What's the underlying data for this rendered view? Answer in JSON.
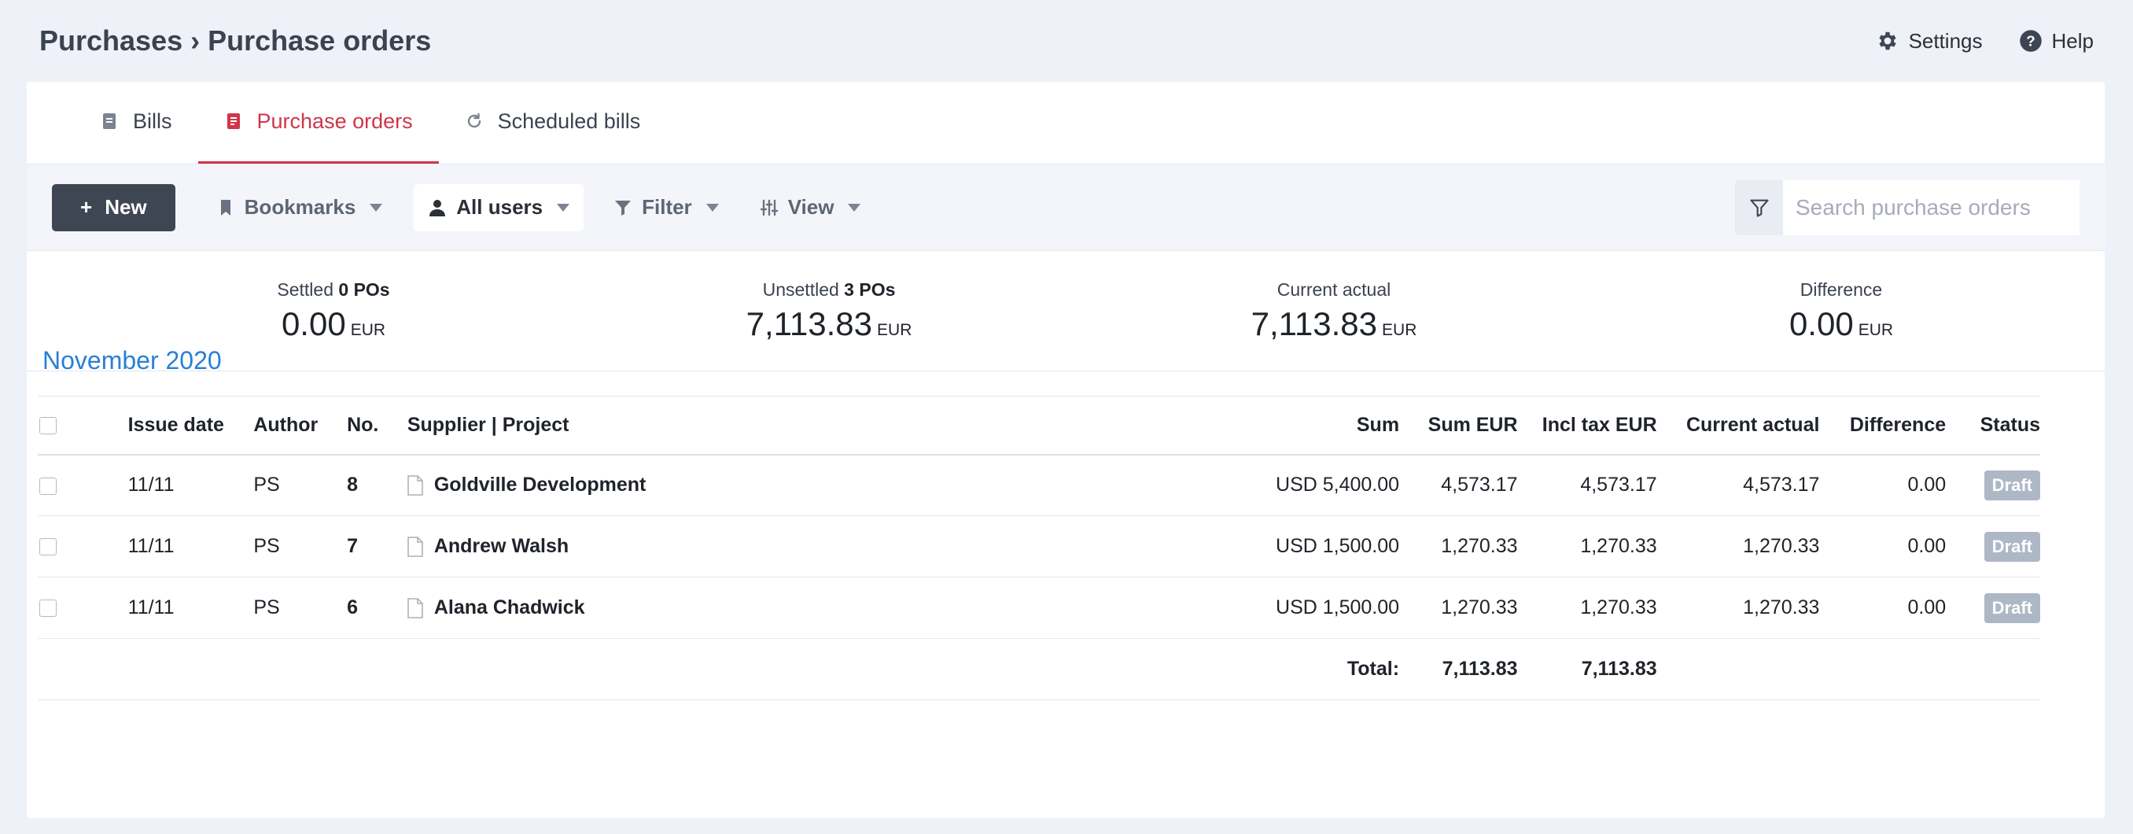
{
  "header": {
    "breadcrumb": "Purchases › Purchase orders",
    "settings_label": "Settings",
    "help_label": "Help"
  },
  "tabs": [
    {
      "label": "Bills",
      "icon": "bill-icon",
      "active": false
    },
    {
      "label": "Purchase orders",
      "icon": "purchase-order-icon",
      "active": true
    },
    {
      "label": "Scheduled bills",
      "icon": "refresh-icon",
      "active": false
    }
  ],
  "toolbar": {
    "new_label": "New",
    "bookmarks_label": "Bookmarks",
    "users_label": "All users",
    "filter_label": "Filter",
    "view_label": "View",
    "search_placeholder": "Search purchase orders"
  },
  "summary": {
    "settled": {
      "label": "Settled",
      "count": "0 POs",
      "value": "0.00",
      "currency": "EUR"
    },
    "unsettled": {
      "label": "Unsettled",
      "count": "3 POs",
      "value": "7,113.83",
      "currency": "EUR"
    },
    "current_actual": {
      "label": "Current actual",
      "value": "7,113.83",
      "currency": "EUR"
    },
    "difference": {
      "label": "Difference",
      "value": "0.00",
      "currency": "EUR"
    }
  },
  "group": {
    "month": "November 2020"
  },
  "table": {
    "columns": {
      "issue_date": "Issue date",
      "author": "Author",
      "no": "No.",
      "supplier": "Supplier | Project",
      "sum": "Sum",
      "sum_eur": "Sum EUR",
      "incl_tax_eur": "Incl tax EUR",
      "current_actual": "Current actual",
      "difference": "Difference",
      "status": "Status"
    },
    "rows": [
      {
        "issue_date": "11/11",
        "author": "PS",
        "no": "8",
        "supplier": "Goldville Development",
        "sum": "USD 5,400.00",
        "sum_eur": "4,573.17",
        "incl_tax_eur": "4,573.17",
        "current_actual": "4,573.17",
        "difference": "0.00",
        "status": "Draft"
      },
      {
        "issue_date": "11/11",
        "author": "PS",
        "no": "7",
        "supplier": "Andrew Walsh",
        "sum": "USD 1,500.00",
        "sum_eur": "1,270.33",
        "incl_tax_eur": "1,270.33",
        "current_actual": "1,270.33",
        "difference": "0.00",
        "status": "Draft"
      },
      {
        "issue_date": "11/11",
        "author": "PS",
        "no": "6",
        "supplier": "Alana Chadwick",
        "sum": "USD 1,500.00",
        "sum_eur": "1,270.33",
        "incl_tax_eur": "1,270.33",
        "current_actual": "1,270.33",
        "difference": "0.00",
        "status": "Draft"
      }
    ],
    "total": {
      "label": "Total:",
      "sum_eur": "7,113.83",
      "incl_tax_eur": "7,113.83"
    }
  },
  "colors": {
    "accent": "#d0354a",
    "link_blue": "#2a7fd4",
    "dark_button": "#3f4653",
    "draft_badge": "#aeb7c5"
  }
}
